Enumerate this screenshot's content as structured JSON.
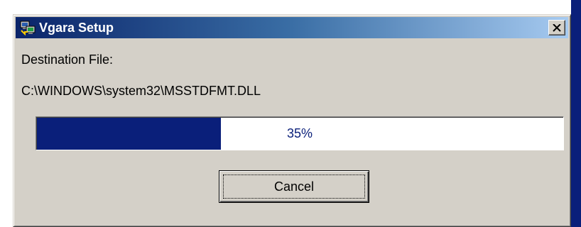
{
  "window": {
    "title": "Vgara Setup",
    "close_symbol": "×"
  },
  "content": {
    "destination_label": "Destination File:",
    "destination_path": "C:\\WINDOWS\\system32\\MSSTDFMT.DLL"
  },
  "progress": {
    "percent": 35,
    "text": "35%"
  },
  "buttons": {
    "cancel_label": "Cancel"
  },
  "icons": {
    "app": "setup-computer-icon",
    "close": "close-icon"
  },
  "colors": {
    "title_gradient_start": "#0a246a",
    "title_gradient_end": "#a6caf0",
    "progress_fill": "#0a1f7a",
    "window_face": "#d4d0c8"
  }
}
